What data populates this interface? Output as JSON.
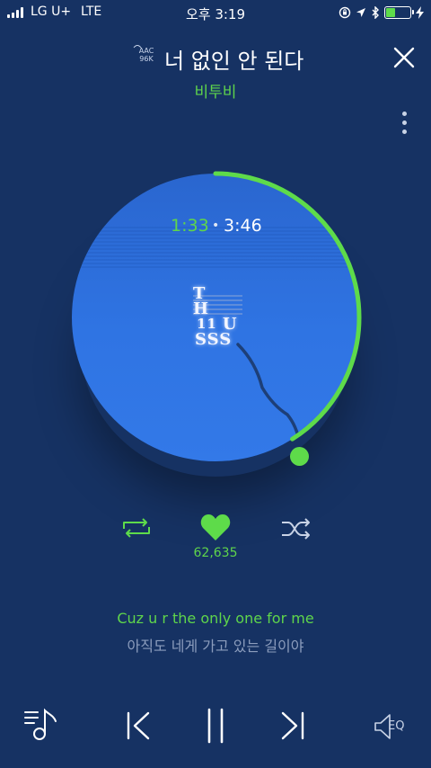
{
  "status_bar": {
    "carrier": "LG U+",
    "network": "LTE",
    "time": "오후 3:19",
    "icons": [
      "orientation-lock-icon",
      "location-icon",
      "bluetooth-icon",
      "battery-icon",
      "charging-icon"
    ]
  },
  "header": {
    "quality_format": "AAC",
    "quality_rate": "96K",
    "song_title": "너 없인 안 된다",
    "artist": "비투비"
  },
  "player": {
    "current_time": "1:33",
    "separator": "•",
    "total_time": "3:46",
    "progress": 0.41,
    "album_art_text": [
      "T",
      "H",
      "11",
      "U",
      "SSS"
    ],
    "like_count": "62,635"
  },
  "lyrics": {
    "current": "Cuz u r the only one for me",
    "next": "아직도 네게 가고 있는 길이야"
  },
  "controls": {
    "eq_label": "EQ"
  },
  "colors": {
    "background": "#163263",
    "accent": "#5edb4a",
    "disc": "#2f74e3"
  }
}
